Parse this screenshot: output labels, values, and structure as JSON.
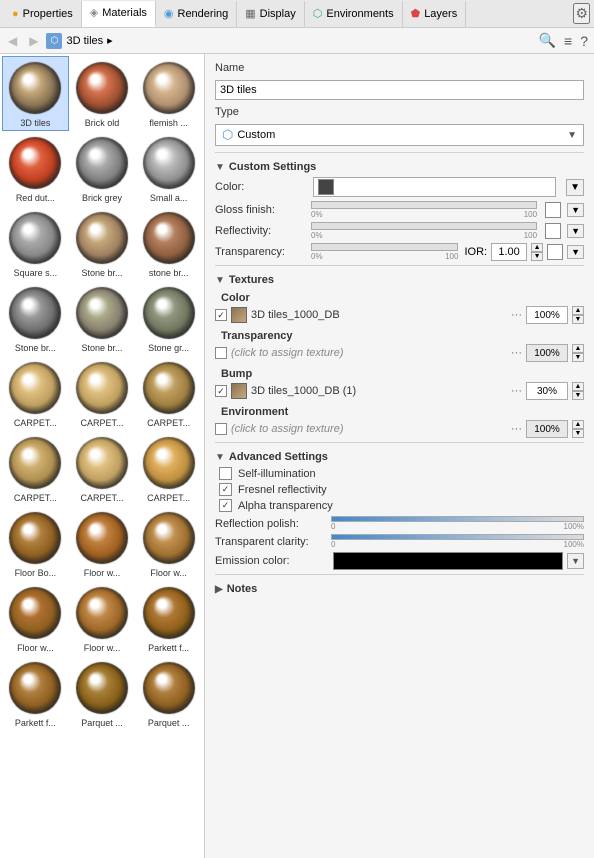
{
  "tabs": [
    {
      "label": "Properties",
      "icon": "properties"
    },
    {
      "label": "Materials",
      "icon": "materials",
      "active": true
    },
    {
      "label": "Rendering",
      "icon": "rendering"
    },
    {
      "label": "Display",
      "icon": "display"
    },
    {
      "label": "Environments",
      "icon": "environments"
    },
    {
      "label": "Layers",
      "icon": "layers"
    }
  ],
  "settings_icon": "⚙",
  "nav": {
    "back_label": "◀",
    "forward_label": "▶",
    "breadcrumb": "3D tiles",
    "breadcrumb_arrow": "▸",
    "search_icon": "🔍",
    "menu_icon": "≡",
    "help_icon": "?"
  },
  "materials": [
    {
      "label": "3D tiles",
      "selected": true,
      "color": "#8b7355",
      "color2": "#c4a87a"
    },
    {
      "label": "Brick old",
      "color": "#a05030",
      "color2": "#d4724e"
    },
    {
      "label": "flemish ...",
      "color": "#b09070",
      "color2": "#d4b48c"
    },
    {
      "label": "Red dut...",
      "color": "#c04020",
      "color2": "#e06040"
    },
    {
      "label": "Brick grey",
      "color": "#808080",
      "color2": "#aaaaaa"
    },
    {
      "label": "Small a...",
      "color": "#909090",
      "color2": "#bbbbbb"
    },
    {
      "label": "Square s...",
      "color": "#888888",
      "color2": "#aaaaaa"
    },
    {
      "label": "Stone br...",
      "color": "#a08060",
      "color2": "#c4a87a"
    },
    {
      "label": "stone br...",
      "color": "#906040",
      "color2": "#b48060"
    },
    {
      "label": "Stone br...",
      "color": "#707070",
      "color2": "#999999"
    },
    {
      "label": "Stone br...",
      "color": "#888070",
      "color2": "#aaaa88"
    },
    {
      "label": "Stone gr...",
      "color": "#707860",
      "color2": "#909880"
    },
    {
      "label": "CARPET...",
      "color": "#c0a060",
      "color2": "#e0c080"
    },
    {
      "label": "CARPET...",
      "color": "#c0a060",
      "color2": "#e0c080"
    },
    {
      "label": "CARPET...",
      "color": "#a08040",
      "color2": "#c0a060"
    },
    {
      "label": "CARPET...",
      "color": "#b09050",
      "color2": "#d0b070"
    },
    {
      "label": "CARPET...",
      "color": "#c0a060",
      "color2": "#e0c080"
    },
    {
      "label": "CARPET...",
      "color": "#c09040",
      "color2": "#e0b060"
    },
    {
      "label": "Floor Bo...",
      "color": "#906020",
      "color2": "#b08040"
    },
    {
      "label": "Floor w...",
      "color": "#a06020",
      "color2": "#c08040"
    },
    {
      "label": "Floor w...",
      "color": "#a07030",
      "color2": "#c09050"
    },
    {
      "label": "Floor w...",
      "color": "#906020",
      "color2": "#b07030"
    },
    {
      "label": "Floor w...",
      "color": "#a06828",
      "color2": "#c08848"
    },
    {
      "label": "Parkett f...",
      "color": "#906018",
      "color2": "#b07838"
    },
    {
      "label": "Parkett f...",
      "color": "#906020",
      "color2": "#b08040"
    },
    {
      "label": "Parquet ...",
      "color": "#886018",
      "color2": "#a88038"
    },
    {
      "label": "Parquet ...",
      "color": "#906020",
      "color2": "#b08040"
    }
  ],
  "name_label": "Name",
  "name_value": "3D tiles",
  "type_label": "Type",
  "type_value": "Custom",
  "type_icon": "⬡",
  "custom_settings": {
    "header": "Custom Settings",
    "color_label": "Color:",
    "color_swatch": "#444444",
    "gloss_label": "Gloss finish:",
    "gloss_min": "0%",
    "gloss_max": "100",
    "gloss_fill": 0,
    "reflectivity_label": "Reflectivity:",
    "reflectivity_min": "0%",
    "reflectivity_max": "100",
    "reflectivity_fill": 0,
    "transparency_label": "Transparency:",
    "transparency_min": "0%",
    "transparency_max": "100",
    "transparency_fill": 0,
    "ior_label": "IOR:",
    "ior_value": "1.00"
  },
  "textures": {
    "header": "Textures",
    "color_sub": "Color",
    "color_tex": {
      "checked": true,
      "name": "3D tiles_1000_DB",
      "pct": "100%"
    },
    "transparency_sub": "Transparency",
    "transparency_tex": {
      "checked": false,
      "name": "(click to assign texture)",
      "pct": "100%"
    },
    "bump_sub": "Bump",
    "bump_tex": {
      "checked": true,
      "name": "3D tiles_1000_DB (1)",
      "pct": "30%"
    },
    "environment_sub": "Environment",
    "environment_tex": {
      "checked": false,
      "name": "(click to assign texture)",
      "pct": "100%"
    }
  },
  "advanced": {
    "header": "Advanced Settings",
    "self_illumination": {
      "label": "Self-illumination",
      "checked": false
    },
    "fresnel": {
      "label": "Fresnel reflectivity",
      "checked": true
    },
    "alpha": {
      "label": "Alpha transparency",
      "checked": true
    },
    "reflection_polish_label": "Reflection polish:",
    "reflection_polish_min": "0",
    "reflection_polish_max": "100%",
    "transparent_clarity_label": "Transparent clarity:",
    "transparent_clarity_min": "0",
    "transparent_clarity_max": "100%",
    "emission_color_label": "Emission color:",
    "emission_color": "#000000"
  },
  "notes": {
    "header": "Notes"
  }
}
